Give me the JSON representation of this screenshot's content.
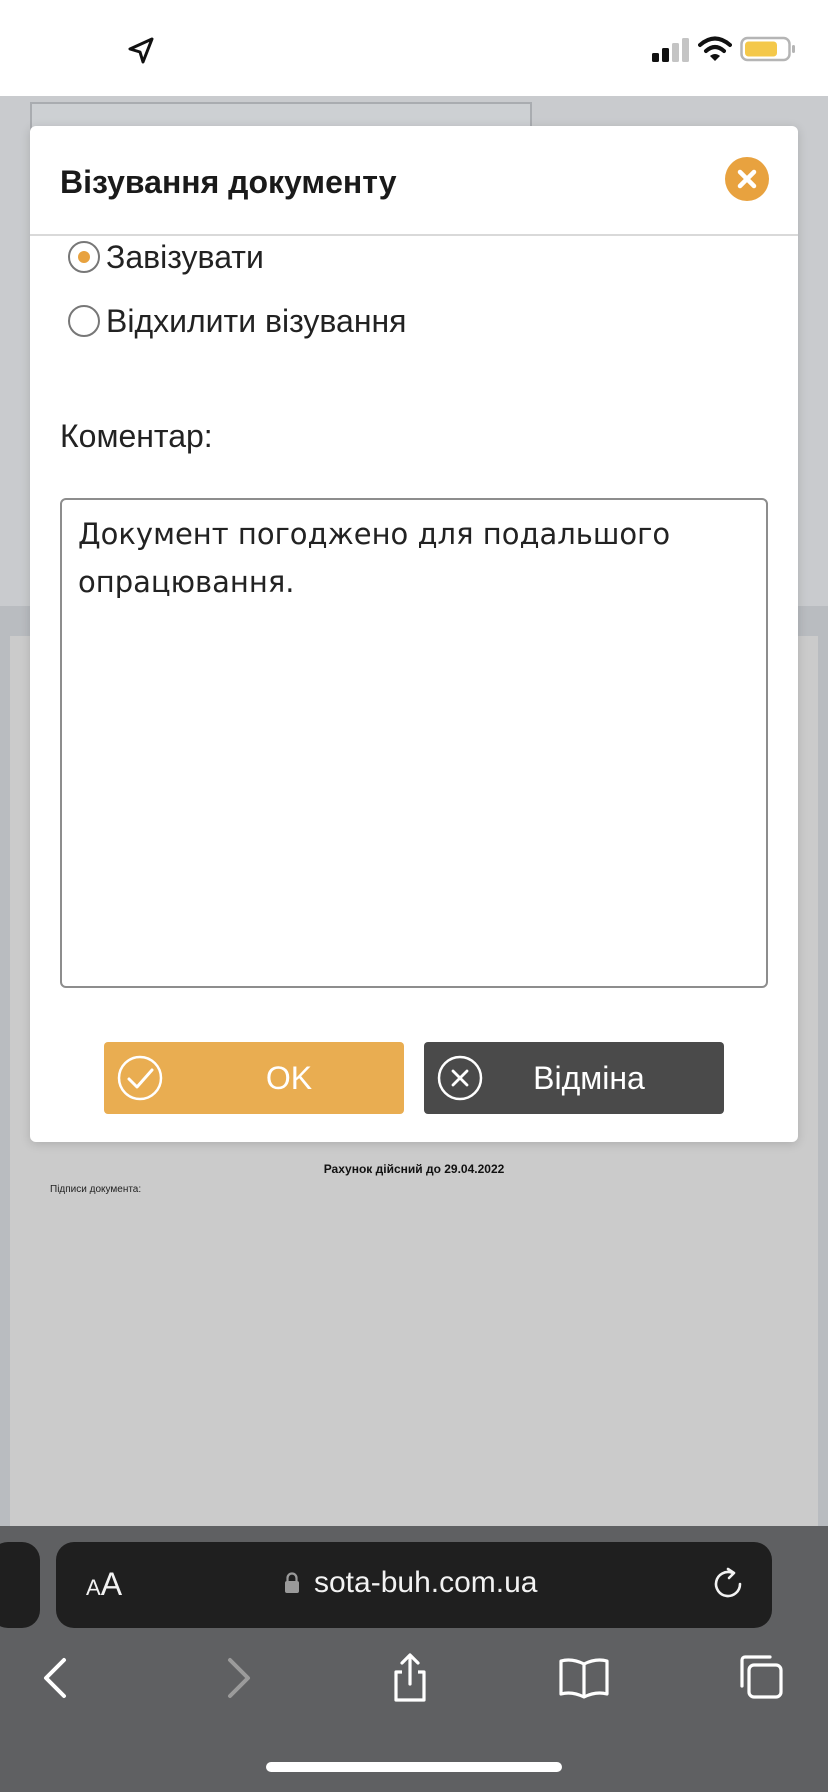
{
  "status_bar": {
    "icons": [
      "location-arrow-icon",
      "cellular-signal-icon",
      "wifi-icon",
      "battery-icon"
    ],
    "battery_color": "#f4c84a"
  },
  "background_page": {
    "valid_until": "Рахунок дійсний до  29.04.2022",
    "signatures_label": "Підписи документа:"
  },
  "modal": {
    "title": "Візування документу",
    "close_icon": "close-icon",
    "options": [
      {
        "label": "Завізувати",
        "selected": true
      },
      {
        "label": "Відхилити візування",
        "selected": false
      }
    ],
    "comment_label": "Коментар:",
    "comment_value": "Документ погоджено для подальшого опрацювання.",
    "ok_label": "OK",
    "cancel_label": "Відміна",
    "accent_color": "#e8a23f",
    "cancel_color": "#4a4a4a"
  },
  "browser": {
    "aa_small": "A",
    "aa_large": "A",
    "url": "sota-buh.com.ua",
    "toolbar_icons": [
      "back-icon",
      "forward-icon",
      "share-icon",
      "bookmarks-icon",
      "tabs-icon"
    ]
  }
}
